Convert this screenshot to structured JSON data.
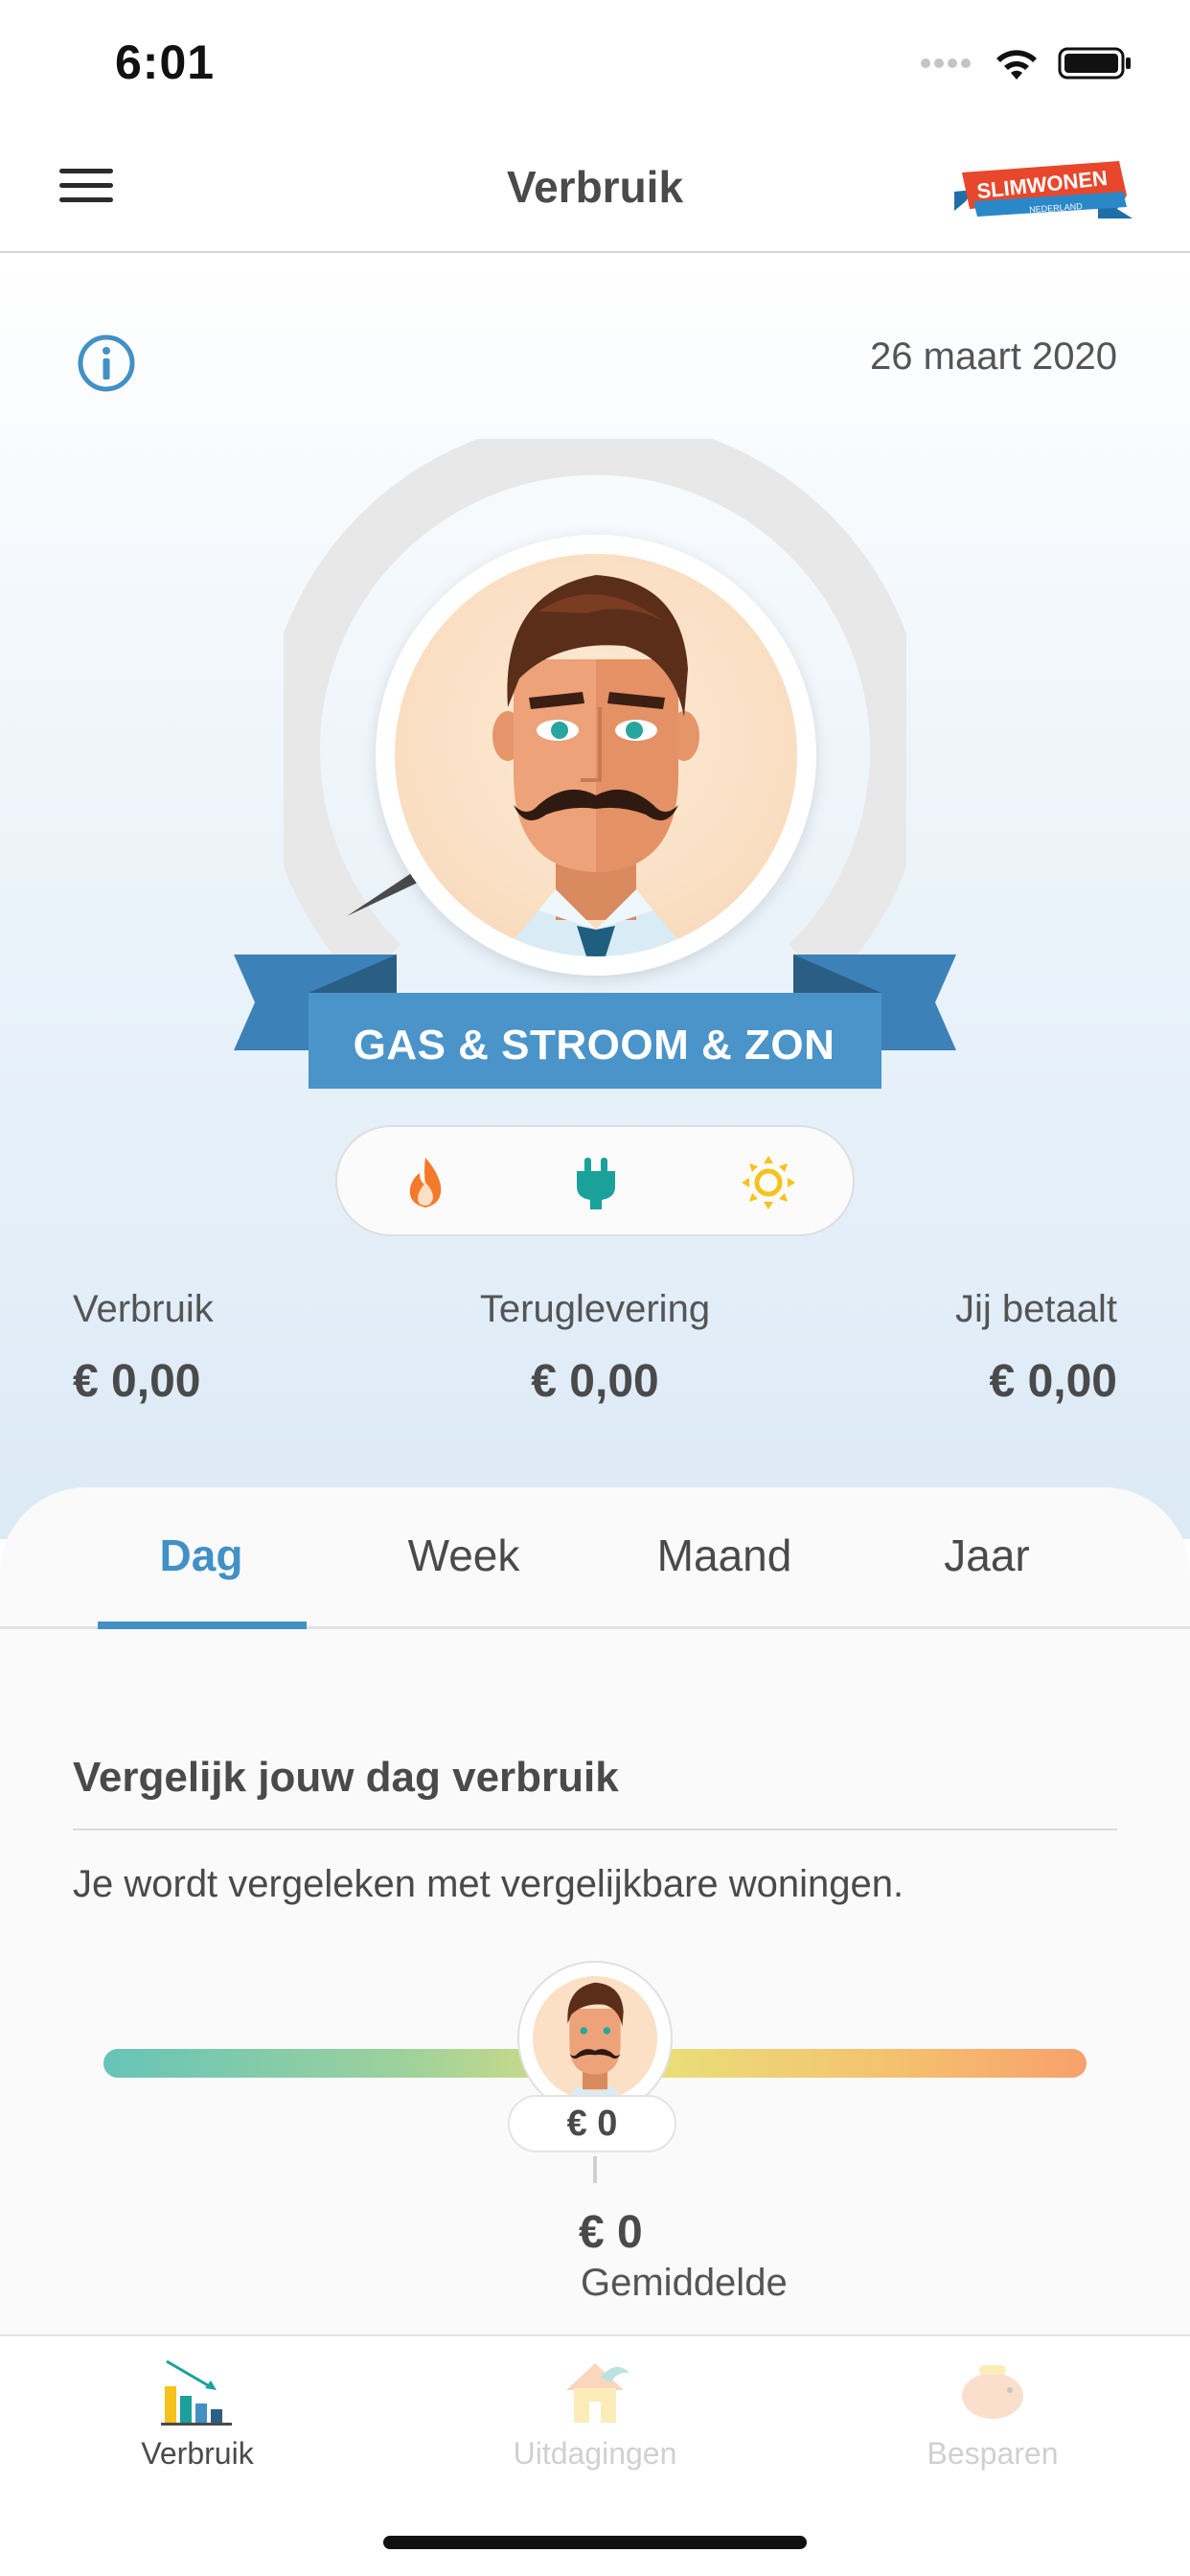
{
  "status_bar": {
    "time": "6:01"
  },
  "nav": {
    "title": "Verbruik",
    "logo_text": "SLIMWONEN",
    "logo_subtext": "NEDERLAND"
  },
  "hero": {
    "date": "26 maart 2020",
    "banner": "GAS & STROOM & ZON",
    "energy_types": [
      "gas",
      "stroom",
      "zon"
    ],
    "stats": [
      {
        "label": "Verbruik",
        "value": "€ 0,00"
      },
      {
        "label": "Teruglevering",
        "value": "€ 0,00"
      },
      {
        "label": "Jij betaalt",
        "value": "€ 0,00"
      }
    ]
  },
  "tabs": [
    "Dag",
    "Week",
    "Maand",
    "Jaar"
  ],
  "active_tab": "Dag",
  "comparison": {
    "title": "Vergelijk jouw dag verbruik",
    "subtitle": "Je wordt vergeleken met vergelijkbare woningen.",
    "your_value": "€ 0",
    "average_value": "€ 0",
    "average_label": "Gemiddelde"
  },
  "bottom_nav": [
    {
      "label": "Verbruik",
      "active": true
    },
    {
      "label": "Uitdagingen",
      "active": false
    },
    {
      "label": "Besparen",
      "active": false
    }
  ],
  "colors": {
    "accent": "#4191c6",
    "banner": "#4a94c9",
    "gas": "#f47a2a",
    "stroom": "#1aa19a",
    "zon": "#f6c21c"
  }
}
